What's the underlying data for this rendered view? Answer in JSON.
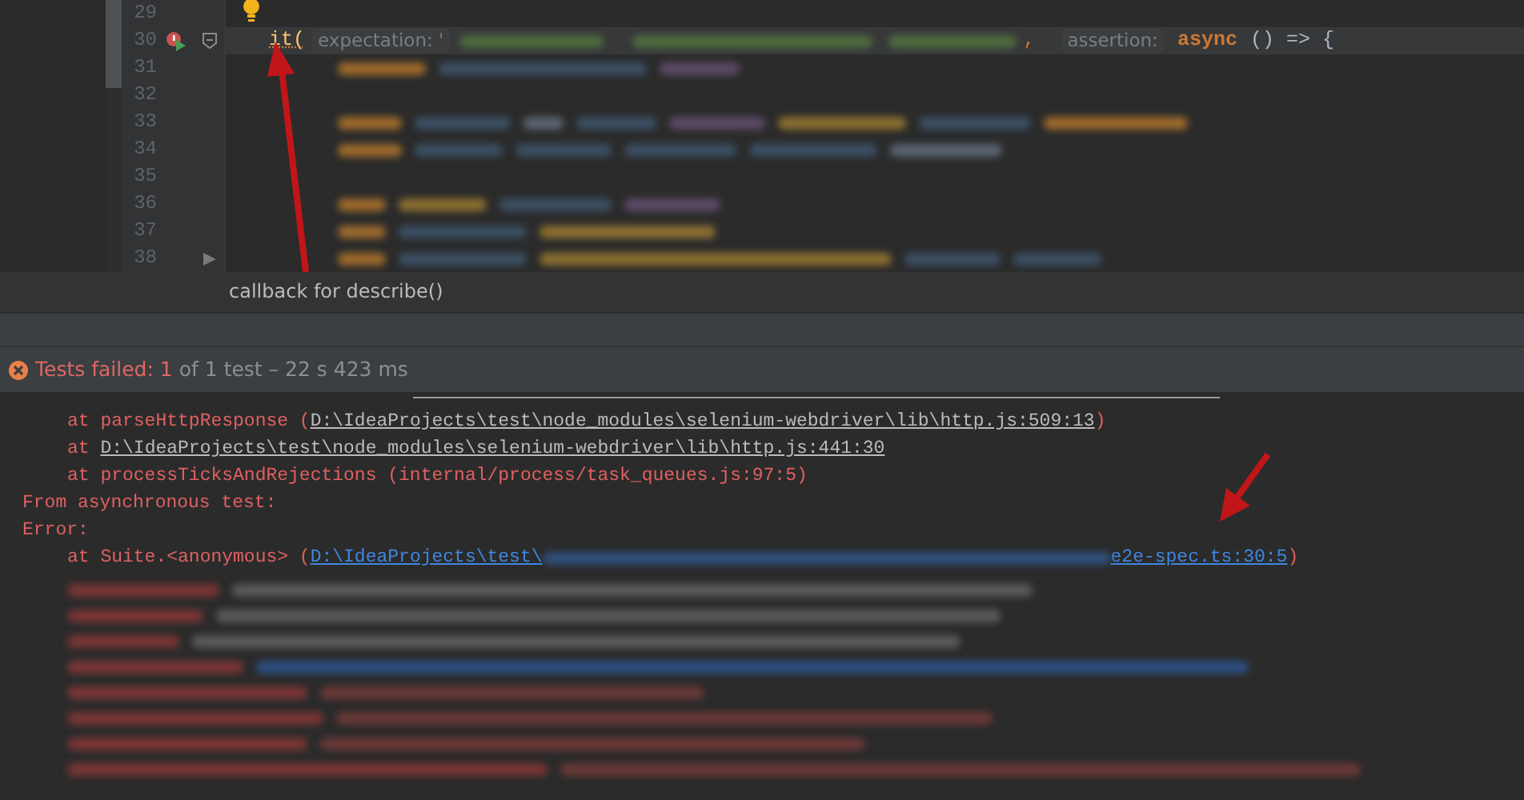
{
  "editor": {
    "lines": [
      {
        "number": "29",
        "kind": "bulb",
        "current": false
      },
      {
        "number": "30",
        "kind": "call",
        "current": true,
        "call": "it(",
        "hint_1": "expectation:",
        "quote": "'",
        "comma": ",",
        "hint_2": "assertion:",
        "keyword": "async",
        "rest": "() => {"
      },
      {
        "number": "31",
        "kind": "blurred",
        "current": false
      },
      {
        "number": "32",
        "kind": "blank",
        "current": false
      },
      {
        "number": "33",
        "kind": "blurred",
        "current": false
      },
      {
        "number": "34",
        "kind": "blurred",
        "current": false
      },
      {
        "number": "35",
        "kind": "blank",
        "current": false
      },
      {
        "number": "36",
        "kind": "blurred",
        "current": false
      },
      {
        "number": "37",
        "kind": "blurred",
        "current": false
      },
      {
        "number": "38",
        "kind": "blurred",
        "current": false,
        "fold_end": true
      }
    ],
    "breadcrumb": "callback for describe()"
  },
  "test_status": {
    "label": "Tests failed:",
    "failed": "1",
    "summary": "of 1 test – 22 s 423 ms"
  },
  "console": {
    "lines": [
      {
        "indent": true,
        "segments": [
          {
            "kind": "text",
            "text": "at parseHttpResponse ("
          },
          {
            "kind": "link",
            "text": "D:\\IdeaProjects\\test\\node_modules\\selenium-webdriver\\lib\\http.js:509:13"
          },
          {
            "kind": "text",
            "text": ")"
          }
        ]
      },
      {
        "indent": true,
        "segments": [
          {
            "kind": "text",
            "text": "at "
          },
          {
            "kind": "link",
            "text": "D:\\IdeaProjects\\test\\node_modules\\selenium-webdriver\\lib\\http.js:441:30"
          }
        ]
      },
      {
        "indent": true,
        "segments": [
          {
            "kind": "text",
            "text": "at processTicksAndRejections (internal/process/task_queues.js:97:5)"
          }
        ]
      },
      {
        "indent": false,
        "segments": [
          {
            "kind": "text",
            "text": "From asynchronous test:"
          }
        ]
      },
      {
        "indent": false,
        "segments": [
          {
            "kind": "text",
            "text": "Error:"
          }
        ]
      },
      {
        "indent": true,
        "segments": [
          {
            "kind": "text",
            "text": "at Suite.<anonymous> ("
          },
          {
            "kind": "source_link",
            "text": "D:\\IdeaProjects\\test\\"
          },
          {
            "kind": "blurred"
          },
          {
            "kind": "source_link",
            "text": "e2e-spec.ts:30:5"
          },
          {
            "kind": "text",
            "text": ")"
          }
        ]
      }
    ]
  }
}
